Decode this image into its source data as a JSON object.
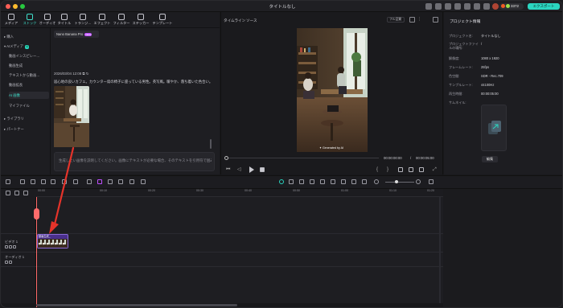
{
  "app": {
    "title": "タイトルなし"
  },
  "titlebar": {
    "credits": "3372",
    "export_label": "エクスポート"
  },
  "toolbar": {
    "items": [
      {
        "label": "メディア",
        "icon": "media-icon"
      },
      {
        "label": "ストック",
        "icon": "stock-icon"
      },
      {
        "label": "オーディオ",
        "icon": "music-note-icon"
      },
      {
        "label": "タイトル",
        "icon": "title-t-icon"
      },
      {
        "label": "トランジ…",
        "icon": "transition-icon"
      },
      {
        "label": "エフェクト",
        "icon": "effects-icon"
      },
      {
        "label": "フィルター",
        "icon": "filter-icon"
      },
      {
        "label": "ステッカー",
        "icon": "sticker-icon"
      },
      {
        "label": "テンプレート",
        "icon": "template-icon"
      }
    ]
  },
  "sidebar": {
    "items": [
      {
        "label": "▸ 購入"
      },
      {
        "label": "▾ AIメディア",
        "badge": "AI"
      },
      {
        "label": "動画インスピレー…"
      },
      {
        "label": "動画生成"
      },
      {
        "label": "テキストから動画…"
      },
      {
        "label": "動画拡長"
      },
      {
        "label": "AI 画像"
      },
      {
        "label": "マイファイル"
      },
      {
        "label": "▸ ライブラリ"
      },
      {
        "label": "▸ パートナー"
      }
    ]
  },
  "gen_pane": {
    "model_label": "Nano Banana Pro",
    "model_tag": "NEW",
    "timestamp": "2026/03/04 12:08",
    "prompt": "居心地の良いカフェ。カウンター席の椅子に座っている男性。英写風。暖やか、落ち着いた色合い。",
    "input_placeholder": "生成したい画像を説明してください。画像にテキストが必要な場合、そのテキストを引用符で囲み"
  },
  "preview": {
    "tabs": [
      "タイムライン",
      "ソース"
    ],
    "fit_label": "フル品質",
    "badge": "Generated by AI",
    "current_time": "00:00:00:00",
    "total_time": "00:00:05:00"
  },
  "properties": {
    "heading": "プロジェクト情報",
    "rows": [
      {
        "k": "プロジェクト名:",
        "v": "タイトルなし"
      },
      {
        "k": "プロジェクトファイルの場所:",
        "v": "/"
      },
      {
        "k": "解像度:",
        "v": "1080 x 1920"
      },
      {
        "k": "フレームレート:",
        "v": "25fps"
      },
      {
        "k": "色空間:",
        "v": "SDR - Rec.709"
      },
      {
        "k": "サンプルレート:",
        "v": "44100Hz"
      },
      {
        "k": "再生時間:",
        "v": "00:00:05:00"
      },
      {
        "k": "サムネイル:",
        "v": ""
      }
    ],
    "edit_label": "編集"
  },
  "timeline": {
    "ruler_ticks": [
      "00:00",
      "00:10",
      "00:20",
      "00:30",
      "00:40",
      "00:50",
      "01:00",
      "01:10",
      "01:20"
    ],
    "tracks": [
      {
        "label": "ビデオ 1"
      },
      {
        "label": "オーディオ 1"
      }
    ],
    "clip_label": "動画生成_"
  },
  "colors": {
    "accent": "#2bd5c0",
    "playhead": "#ff6b6b",
    "clip": "#4a2f8c",
    "annotation_arrow": "#e5332a"
  }
}
